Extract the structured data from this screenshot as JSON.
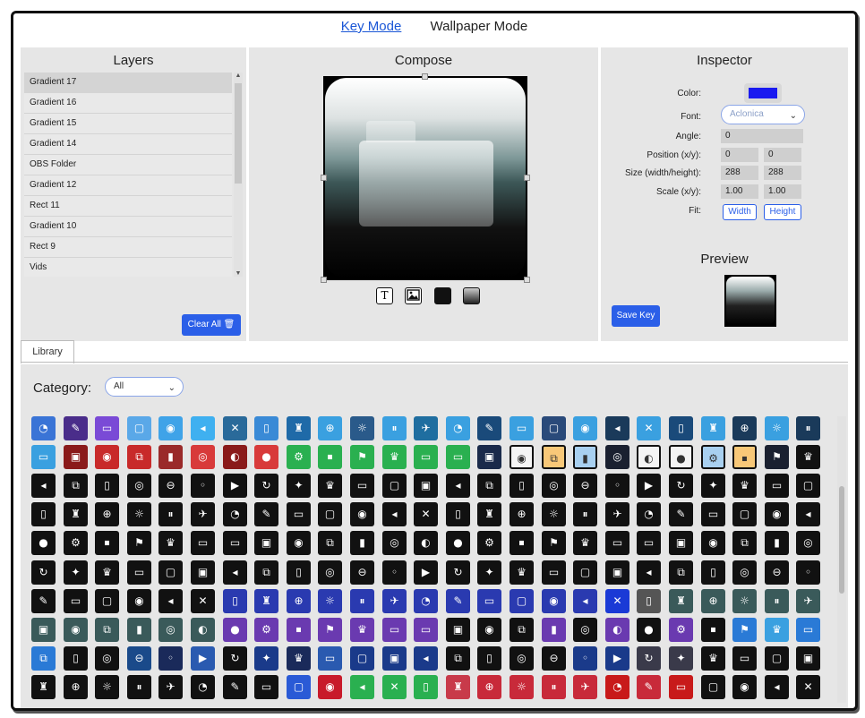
{
  "modes": {
    "key_mode": "Key Mode",
    "wallpaper_mode": "Wallpaper Mode"
  },
  "layers": {
    "title": "Layers",
    "items": [
      "Gradient 17",
      "Gradient 16",
      "Gradient 15",
      "Gradient 14",
      "OBS Folder",
      "Gradient 12",
      "Rect 11",
      "Gradient 10",
      "Rect 9",
      "Vids"
    ],
    "selected_index": 0,
    "clear_all_label": "Clear All 🗑"
  },
  "compose": {
    "title": "Compose",
    "tools": {
      "text_icon": "T",
      "image_icon": "image-icon",
      "solid_icon": "solid-fill-icon",
      "gradient_icon": "gradient-fill-icon"
    }
  },
  "inspector": {
    "title": "Inspector",
    "color_label": "Color:",
    "color_value": "#1a1af0",
    "font_label": "Font:",
    "font_value": "Aclonica",
    "angle_label": "Angle:",
    "angle_value": "0",
    "position_label": "Position (x/y):",
    "position_x": "0",
    "position_y": "0",
    "size_label": "Size (width/height):",
    "size_w": "288",
    "size_h": "288",
    "scale_label": "Scale (x/y):",
    "scale_x": "1.00",
    "scale_y": "1.00",
    "fit_label": "Fit:",
    "fit_width": "Width",
    "fit_height": "Height",
    "preview_title": "Preview",
    "save_key_label": "Save Key"
  },
  "library": {
    "tab_label": "Library",
    "category_label": "Category:",
    "category_value": "All",
    "rows": [
      [
        "#3a74d6",
        "#4a2d8a",
        "#7a4ad6",
        "#5aa8e8",
        "#3fa3e8",
        "#3fb0f0",
        "#2a6a9a",
        "#3a8ad6",
        "#1f6aa8",
        "#3aa0e0",
        "#2a5a8a",
        "#3aa0e0",
        "#1f6ea0",
        "#3aa0e0",
        "#1a4a7a",
        "#3aa0e0",
        "#2a4a7a",
        "#3aa0e0",
        "#1a3a5a",
        "#3aa0e0",
        "#1a4a7a",
        "#3aa0e0",
        "#1a3a5a",
        "#3aa0e0",
        "#1a3a5a"
      ],
      [
        "#3aa0e0",
        "#8a1a1a",
        "#c82a2a",
        "#c82a2a",
        "#9a2a2a",
        "#d83a3a",
        "#8a1a1a",
        "#d83a3a",
        "#2ab050",
        "#2ab050",
        "#2ab050",
        "#2ab050",
        "#2ab050",
        "#2ab050",
        "#1a2a4a",
        "#f4f4f4",
        "#f8c878",
        "#a8d0f0",
        "#1a2030",
        "#f4f4f4",
        "#f4f4f4",
        "#a8d0f0",
        "#f8c878",
        "#1a2030",
        "#111111"
      ],
      [
        "#111111",
        "#111111",
        "#111111",
        "#111111",
        "#111111",
        "#111111",
        "#111111",
        "#111111",
        "#111111",
        "#111111",
        "#111111",
        "#111111",
        "#111111",
        "#111111",
        "#111111",
        "#111111",
        "#111111",
        "#111111",
        "#111111",
        "#111111",
        "#111111",
        "#111111",
        "#111111",
        "#111111",
        "#111111"
      ],
      [
        "#111111",
        "#111111",
        "#111111",
        "#111111",
        "#111111",
        "#111111",
        "#111111",
        "#111111",
        "#111111",
        "#111111",
        "#111111",
        "#111111",
        "#111111",
        "#111111",
        "#111111",
        "#111111",
        "#111111",
        "#111111",
        "#111111",
        "#111111",
        "#111111",
        "#111111",
        "#111111",
        "#111111",
        "#111111"
      ],
      [
        "#111111",
        "#111111",
        "#111111",
        "#111111",
        "#111111",
        "#111111",
        "#111111",
        "#111111",
        "#111111",
        "#111111",
        "#111111",
        "#111111",
        "#111111",
        "#111111",
        "#111111",
        "#111111",
        "#111111",
        "#111111",
        "#111111",
        "#111111",
        "#111111",
        "#111111",
        "#111111",
        "#111111",
        "#111111"
      ],
      [
        "#111111",
        "#111111",
        "#111111",
        "#111111",
        "#111111",
        "#111111",
        "#111111",
        "#111111",
        "#111111",
        "#111111",
        "#111111",
        "#111111",
        "#111111",
        "#111111",
        "#111111",
        "#111111",
        "#111111",
        "#111111",
        "#111111",
        "#111111",
        "#111111",
        "#111111",
        "#111111",
        "#111111",
        "#111111"
      ],
      [
        "#111111",
        "#111111",
        "#111111",
        "#111111",
        "#111111",
        "#111111",
        "#2a3ab0",
        "#2a3ab0",
        "#2a3ab0",
        "#2a3ab0",
        "#2a3ab0",
        "#2a3ab0",
        "#2a3ab0",
        "#2a3ab0",
        "#2a3ab0",
        "#2a3ab0",
        "#2a3ab0",
        "#2a3ab0",
        "#1a3ad6",
        "#555555",
        "#3a5a5a",
        "#3a5a5a",
        "#3a5a5a",
        "#3a5a5a",
        "#3a5a5a"
      ],
      [
        "#3a5a5a",
        "#3a5a5a",
        "#3a5a5a",
        "#3a5a5a",
        "#3a5a5a",
        "#3a5a5a",
        "#6a3ab0",
        "#6a3ab0",
        "#6a3ab0",
        "#6a3ab0",
        "#6a3ab0",
        "#6a3ab0",
        "#6a3ab0",
        "#111111",
        "#111111",
        "#111111",
        "#6a3ab0",
        "#111111",
        "#6a3ab0",
        "#111111",
        "#6a3ab0",
        "#111111",
        "#2a7ad6",
        "#3aa0e0",
        "#2a7ad6"
      ],
      [
        "#2a7ad6",
        "#111111",
        "#111111",
        "#1a4a8a",
        "#1a2a5a",
        "#2a5ab0",
        "#111111",
        "#1a3a8a",
        "#1a2a5a",
        "#2a5ab0",
        "#1a3a8a",
        "#1a3a8a",
        "#1a3a8a",
        "#111111",
        "#111111",
        "#111111",
        "#111111",
        "#1a3a8a",
        "#1a3a8a",
        "#3a3a4a",
        "#3a3a4a",
        "#111111",
        "#111111",
        "#111111",
        "#111111"
      ],
      [
        "#111111",
        "#111111",
        "#111111",
        "#111111",
        "#111111",
        "#111111",
        "#111111",
        "#111111",
        "#2a5ad6",
        "#c81a2a",
        "#2ab050",
        "#2ab050",
        "#2ab050",
        "#c83a4a",
        "#c82a3a",
        "#c82a3a",
        "#c82a3a",
        "#c82a3a",
        "#c81a1a",
        "#c82a3a",
        "#c81a1a",
        "#111111",
        "#111111",
        "#111111",
        "#111111"
      ]
    ]
  }
}
